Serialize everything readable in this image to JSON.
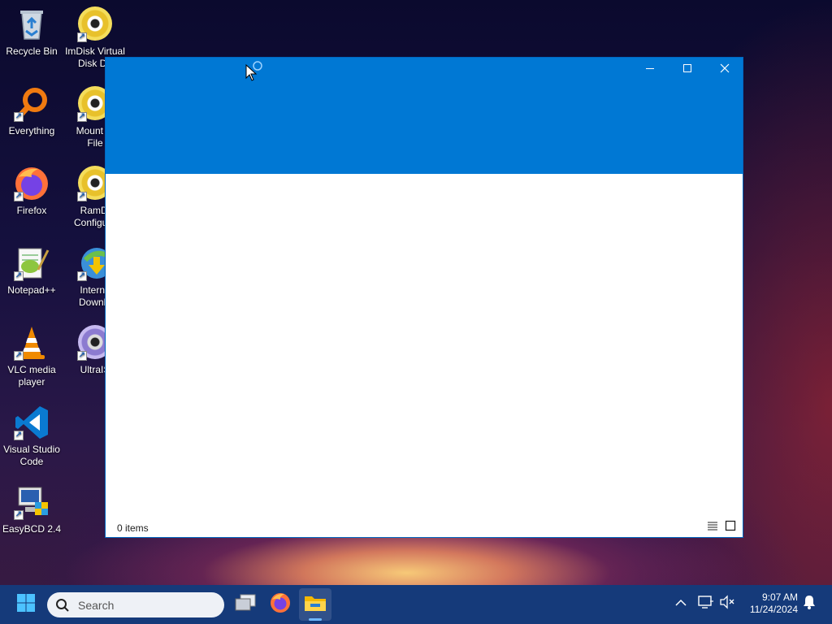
{
  "desktop": {
    "icons": [
      {
        "label": "Recycle Bin",
        "icon": "recycle-bin-icon"
      },
      {
        "label": "ImDisk Virtual\nDisk Dri",
        "icon": "imdisk-disc-icon"
      },
      {
        "label": "Everything",
        "icon": "everything-search-icon"
      },
      {
        "label": "Mount In\nFile",
        "icon": "mount-image-disc-icon"
      },
      {
        "label": "Firefox",
        "icon": "firefox-icon"
      },
      {
        "label": "RamDi\nConfigura",
        "icon": "ramdisk-disc-icon"
      },
      {
        "label": "Notepad++",
        "icon": "notepad-plus-plus-icon"
      },
      {
        "label": "Interne\nDownlo",
        "icon": "internet-download-manager-icon"
      },
      {
        "label": "VLC media\nplayer",
        "icon": "vlc-cone-icon"
      },
      {
        "label": "UltraIS",
        "icon": "ultraiso-disc-icon"
      },
      {
        "label": "Visual Studio\nCode",
        "icon": "vscode-icon"
      },
      {
        "label": "EasyBCD 2.4",
        "icon": "easybcd-icon"
      }
    ]
  },
  "window": {
    "status_text": "0 items",
    "header_color": "#0078d4",
    "controls": [
      "minimize-icon",
      "maximize-icon",
      "close-icon"
    ]
  },
  "taskbar": {
    "search_placeholder": "Search",
    "time": "9:07 AM",
    "date": "11/24/2024",
    "pinned": [
      "start-windows-icon",
      "task-view-icon",
      "firefox-icon",
      "file-explorer-icon"
    ],
    "background": "#153a7a"
  }
}
